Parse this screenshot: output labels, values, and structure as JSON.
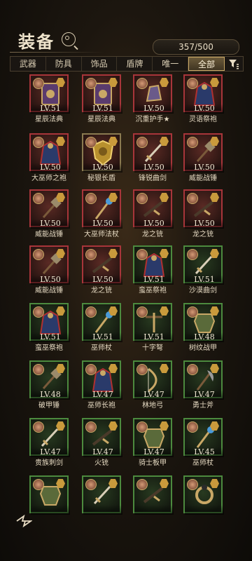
{
  "header": {
    "title": "装备"
  },
  "count": "357/500",
  "tabs": [
    "武器",
    "防具",
    "饰品",
    "盾牌",
    "唯一",
    "全部"
  ],
  "active_tab_index": 5,
  "items": [
    {
      "level": "LV.51",
      "name": "星辰法典",
      "frame": "red",
      "art": "book"
    },
    {
      "level": "LV.51",
      "name": "星辰法典",
      "frame": "red",
      "art": "book"
    },
    {
      "level": "LV.50",
      "name": "沉重护手★",
      "frame": "red",
      "art": "gauntlet"
    },
    {
      "level": "LV.50",
      "name": "灵语祭袍",
      "frame": "red",
      "art": "robe"
    },
    {
      "level": "LV.50",
      "name": "大巫师之袍",
      "frame": "red",
      "art": "robe"
    },
    {
      "level": "LV.50",
      "name": "秘银长盾",
      "frame": "gold",
      "art": "shield"
    },
    {
      "level": "LV.50",
      "name": "锋锐曲剑",
      "frame": "red",
      "art": "sword"
    },
    {
      "level": "LV.50",
      "name": "威能战锤",
      "frame": "red",
      "art": "hammer"
    },
    {
      "level": "LV.50",
      "name": "威能战锤",
      "frame": "red",
      "art": "hammer"
    },
    {
      "level": "LV.50",
      "name": "大巫师法杖",
      "frame": "red",
      "art": "staff"
    },
    {
      "level": "LV.50",
      "name": "龙之铳",
      "frame": "red",
      "art": "gun"
    },
    {
      "level": "LV.50",
      "name": "龙之铳",
      "frame": "red",
      "art": "gun"
    },
    {
      "level": "LV.50",
      "name": "威能战锤",
      "frame": "red",
      "art": "hammer"
    },
    {
      "level": "LV.50",
      "name": "龙之铳",
      "frame": "red",
      "art": "gun"
    },
    {
      "level": "LV.51",
      "name": "蛮巫祭袍",
      "frame": "green",
      "art": "robe"
    },
    {
      "level": "LV.51",
      "name": "沙漠曲剑",
      "frame": "green",
      "art": "sword"
    },
    {
      "level": "LV.51",
      "name": "蛮巫祭袍",
      "frame": "green",
      "art": "robe"
    },
    {
      "level": "LV.51",
      "name": "巫师杖",
      "frame": "green",
      "art": "staff"
    },
    {
      "level": "LV.51",
      "name": "十字弩",
      "frame": "green",
      "art": "crossbow"
    },
    {
      "level": "LV.48",
      "name": "树纹战甲",
      "frame": "green",
      "art": "armor"
    },
    {
      "level": "LV.48",
      "name": "破甲锤",
      "frame": "green",
      "art": "hammer"
    },
    {
      "level": "LV.47",
      "name": "巫师长袍",
      "frame": "green",
      "art": "robe"
    },
    {
      "level": "LV.47",
      "name": "林地弓",
      "frame": "green",
      "art": "bow"
    },
    {
      "level": "LV.47",
      "name": "勇士斧",
      "frame": "green",
      "art": "axe"
    },
    {
      "level": "LV.47",
      "name": "贵族刺剑",
      "frame": "green",
      "art": "sword"
    },
    {
      "level": "LV.47",
      "name": "火铳",
      "frame": "green",
      "art": "gun"
    },
    {
      "level": "LV.47",
      "name": "骑士板甲",
      "frame": "green",
      "art": "armor"
    },
    {
      "level": "LV.45",
      "name": "巫师杖",
      "frame": "green",
      "art": "staff"
    },
    {
      "level": "",
      "name": "",
      "frame": "green",
      "art": "armor"
    },
    {
      "level": "",
      "name": "",
      "frame": "green",
      "art": "sword"
    },
    {
      "level": "",
      "name": "",
      "frame": "green",
      "art": "gun"
    },
    {
      "level": "",
      "name": "",
      "frame": "green",
      "art": "ring"
    }
  ]
}
